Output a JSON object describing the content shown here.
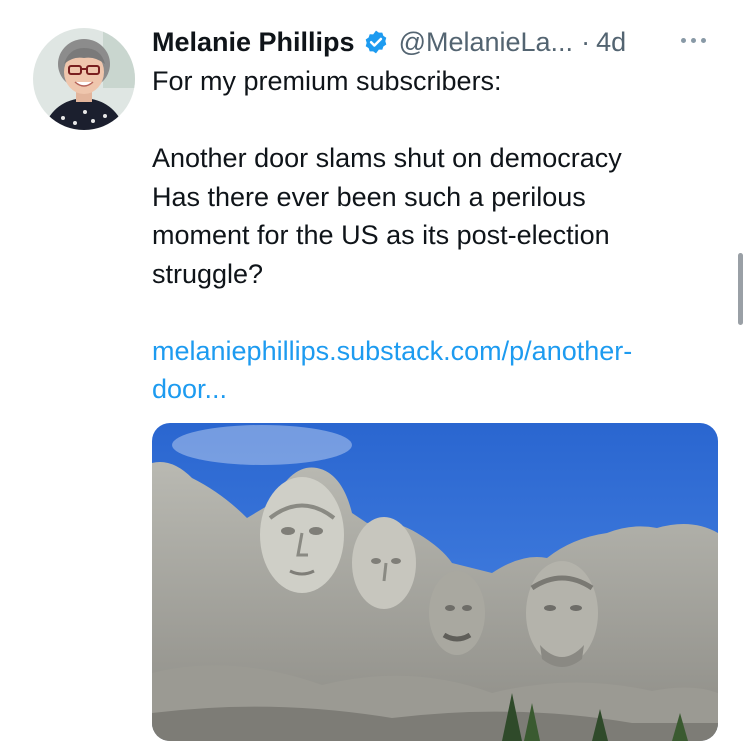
{
  "tweet": {
    "author_name": "Melanie Phillips",
    "verified_icon": "verified-badge-icon",
    "handle": "@MelanieLa...",
    "separator": "·",
    "time": "4d",
    "more_icon": "more-options-icon",
    "text_lines": [
      "For my premium subscribers:",
      "Another door slams shut on democracy",
      "Has there ever been such a perilous",
      "moment for the US as its post-election",
      "struggle?"
    ],
    "link_lines": [
      "melaniephillips.substack.com/p/another-",
      "door..."
    ],
    "media_icon": "mount-rushmore-photo",
    "avatar_icon": "profile-photo-avatar"
  },
  "colors": {
    "link": "#1d9bf0",
    "verified": "#1d9bf0",
    "secondary_text": "#536471",
    "sky": "#2f6fd6"
  }
}
